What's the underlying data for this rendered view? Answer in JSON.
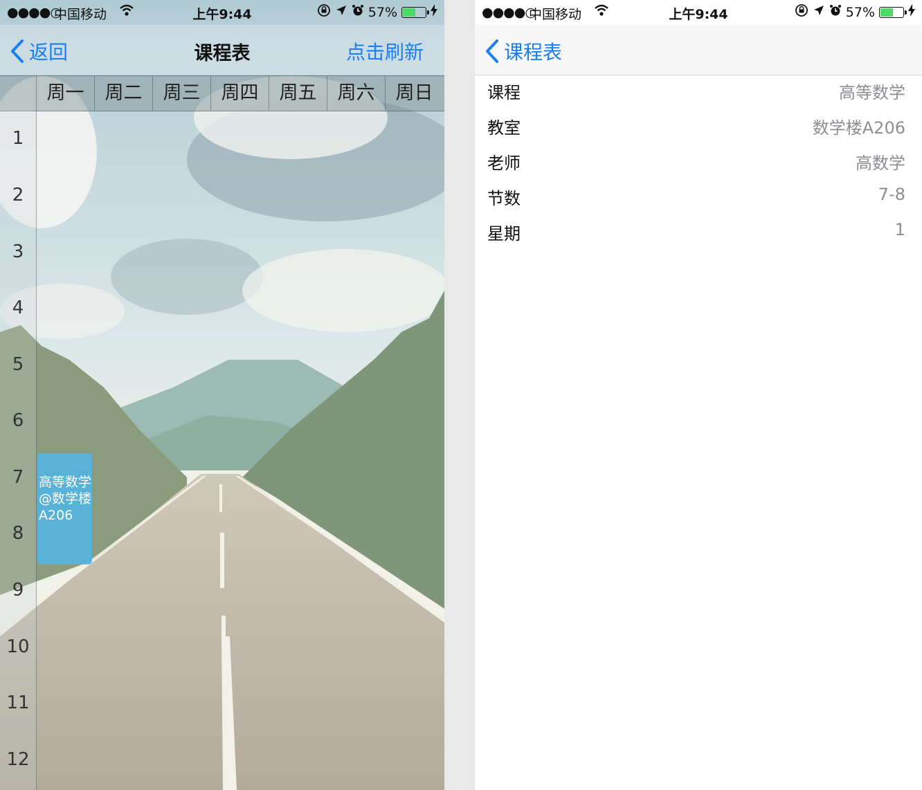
{
  "status_bar": {
    "signal": "●●●●○",
    "carrier": "中国移动",
    "wifi_icon": "wifi-icon",
    "time": "上午9:44",
    "battery": "57%",
    "battery_level": 0.57
  },
  "schedule_screen": {
    "nav": {
      "back_label": "返回",
      "title": "课程表",
      "refresh_label": "点击刷新"
    },
    "weekdays": [
      "周一",
      "周二",
      "周三",
      "周四",
      "周五",
      "周六",
      "周日"
    ],
    "periods": [
      "1",
      "2",
      "3",
      "4",
      "5",
      "6",
      "7",
      "8",
      "9",
      "10",
      "11",
      "12"
    ],
    "course": {
      "text": "高等数学@数学楼A206",
      "day": 1,
      "periods": "7-8"
    }
  },
  "detail_screen": {
    "nav": {
      "back_label": "课程表"
    },
    "rows": [
      {
        "label": "课程",
        "value": "高等数学"
      },
      {
        "label": "教室",
        "value": "数学楼A206"
      },
      {
        "label": "老师",
        "value": "高数学"
      },
      {
        "label": "节数",
        "value": "7-8"
      },
      {
        "label": "星期",
        "value": "1"
      }
    ]
  },
  "colors": {
    "accent": "#1a7ff2",
    "course_card": "#54b4e0",
    "battery_fill": "#4cd964"
  }
}
